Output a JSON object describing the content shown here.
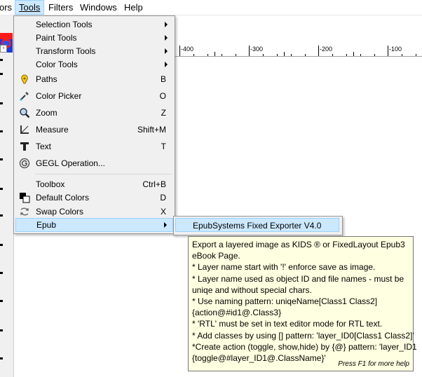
{
  "menubar": {
    "items": [
      {
        "label": "ors"
      },
      {
        "label": "Tools"
      },
      {
        "label": "Filters"
      },
      {
        "label": "Windows"
      },
      {
        "label": "Help"
      }
    ]
  },
  "ruler": {
    "labels": [
      "-400",
      "-300",
      "-200",
      "-100"
    ]
  },
  "tools_menu": {
    "items": [
      {
        "label": "Selection Tools",
        "shortcut": ""
      },
      {
        "label": "Paint Tools",
        "shortcut": ""
      },
      {
        "label": "Transform Tools",
        "shortcut": ""
      },
      {
        "label": "Color Tools",
        "shortcut": ""
      },
      {
        "label": "Paths",
        "shortcut": "B"
      },
      {
        "label": "Color Picker",
        "shortcut": "O"
      },
      {
        "label": "Zoom",
        "shortcut": "Z"
      },
      {
        "label": "Measure",
        "shortcut": "Shift+M"
      },
      {
        "label": "Text",
        "shortcut": "T"
      },
      {
        "label": "GEGL Operation...",
        "shortcut": ""
      },
      {
        "label": "Toolbox",
        "shortcut": "Ctrl+B"
      },
      {
        "label": "Default Colors",
        "shortcut": "D"
      },
      {
        "label": "Swap Colors",
        "shortcut": "X"
      },
      {
        "label": "Epub",
        "shortcut": ""
      }
    ]
  },
  "submenu": {
    "item": "EpubSystems Fixed Exporter V4.0"
  },
  "tooltip": {
    "lines": [
      "Export a layered image as KIDS ® or FixedLayout Epub3",
      "eBook Page.",
      "* Layer name start with '!' enforce save as image.",
      "* Layer name used as object ID and file names - must be",
      "uniqe and without special chars.",
      "* Use naming pattern: uniqeName[Class1 Class2]",
      "{action@#id1@.Class3}",
      "* 'RTL' must be set in text editor mode for RTL text.",
      "* Add classes by using [] pattern: 'layer_ID0[Class1 Class2]'",
      "*Create action (toggle, show,hide) by {@} pattern: 'layer_ID1",
      "{toggle@#layer_ID1@.ClassName}'"
    ],
    "help": "Press F1 for more help"
  },
  "colors": {
    "menu_bg": "#f0f0f0",
    "highlight": "#cce8ff",
    "tooltip_bg": "#ffffe1"
  }
}
